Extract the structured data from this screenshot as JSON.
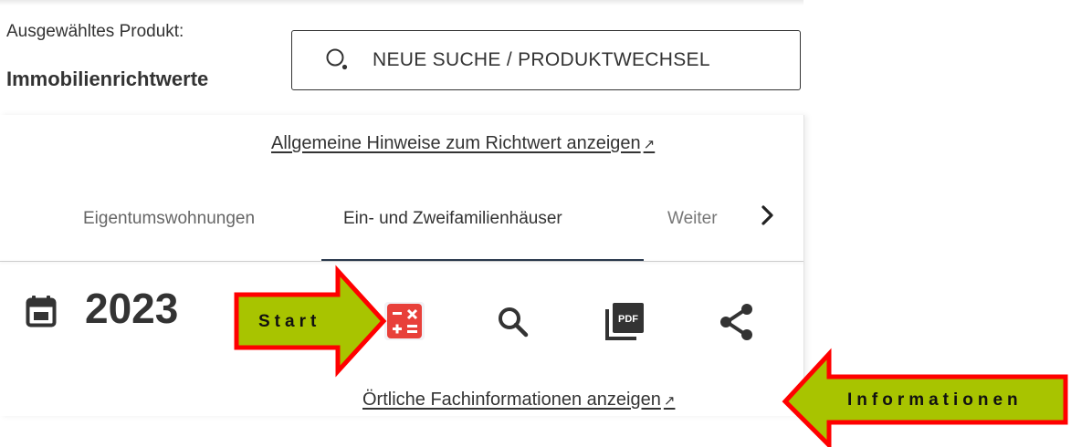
{
  "header": {
    "selected_label": "Ausgewähltes Produkt:",
    "selected_product": "Immobilienrichtwerte",
    "search_button": "NEUE SUCHE / PRODUKTWECHSEL"
  },
  "links": {
    "general_hints": "Allgemeine Hinweise zum Richtwert anzeigen",
    "local_info": "Örtliche Fachinformationen anzeigen",
    "external_glyph": "↗"
  },
  "tabs": [
    {
      "label": "Eigentumswohnungen",
      "active": false
    },
    {
      "label": "Ein- und Zweifamilienhäuser",
      "active": true
    },
    {
      "label": "Weiter",
      "active": false
    }
  ],
  "toolbar": {
    "year": "2023",
    "icons": [
      "calendar-icon",
      "calculator-icon",
      "search-icon",
      "pdf-icon",
      "share-icon",
      "chevron-right-icon"
    ]
  },
  "annotations": {
    "start": "Start",
    "informationen": "Informationen"
  },
  "colors": {
    "arrow_fill": "#a8c400",
    "arrow_border": "#ff0000",
    "calculator_red": "#e8403a",
    "tab_active_underline": "#2b3a4e",
    "text": "#333333"
  }
}
